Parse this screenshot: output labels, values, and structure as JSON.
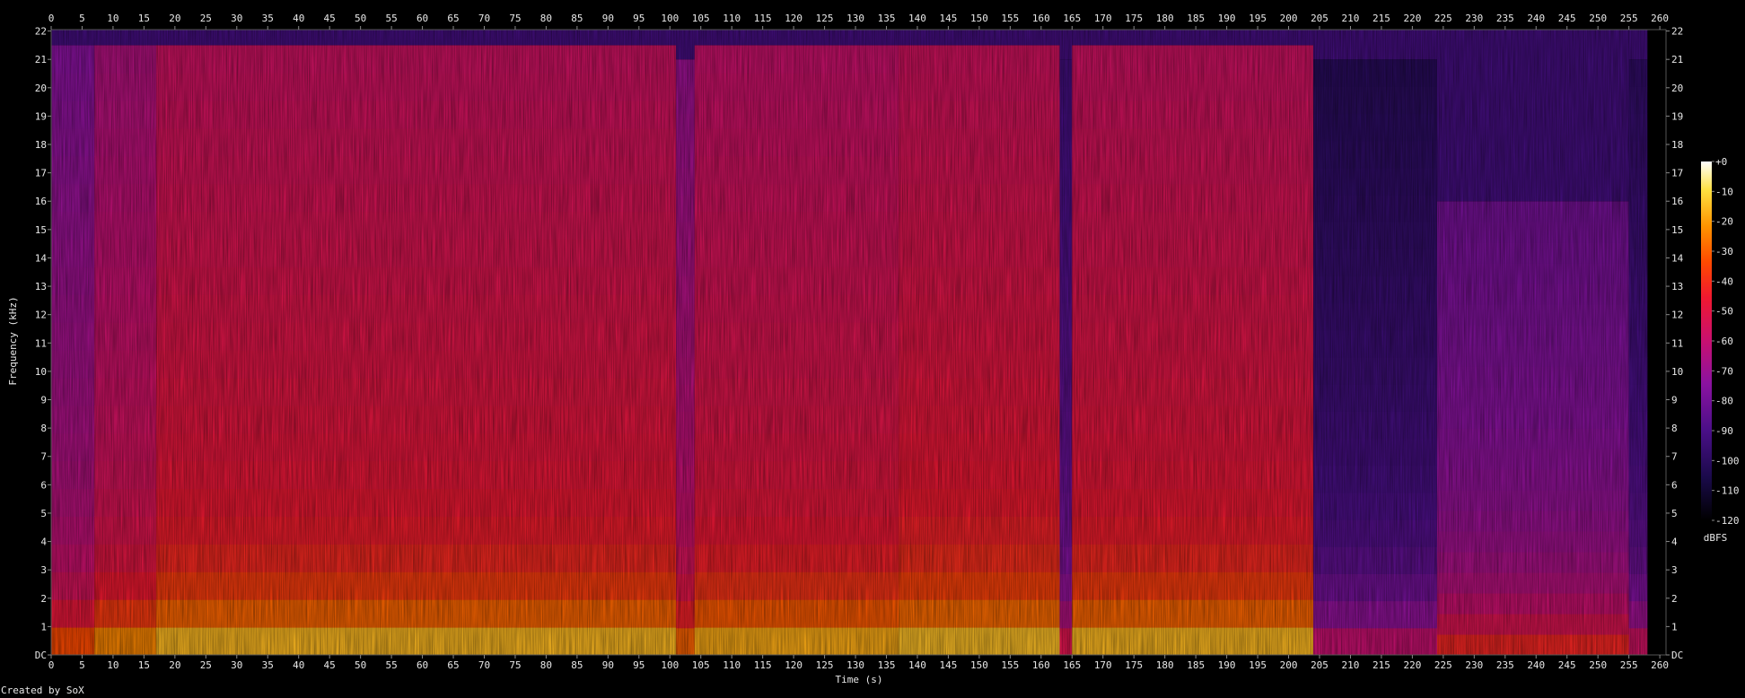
{
  "chart_data": {
    "type": "heatmap",
    "title": "",
    "xlabel": "Time (s)",
    "ylabel": "Frequency (kHz)",
    "xlim": [
      0,
      261
    ],
    "ylim": [
      0,
      22.05
    ],
    "x_ticks": [
      0,
      5,
      10,
      15,
      20,
      25,
      30,
      35,
      40,
      45,
      50,
      55,
      60,
      65,
      70,
      75,
      80,
      85,
      90,
      95,
      100,
      105,
      110,
      115,
      120,
      125,
      130,
      135,
      140,
      145,
      150,
      155,
      160,
      165,
      170,
      175,
      180,
      185,
      190,
      195,
      200,
      205,
      210,
      215,
      220,
      225,
      230,
      235,
      240,
      245,
      250,
      255,
      260
    ],
    "y_ticks": [
      "DC",
      "1",
      "2",
      "3",
      "4",
      "5",
      "6",
      "7",
      "8",
      "9",
      "10",
      "11",
      "12",
      "13",
      "14",
      "15",
      "16",
      "17",
      "18",
      "19",
      "20",
      "21",
      "22"
    ],
    "colorbar": {
      "label": "dBFS",
      "ticks": [
        "+0",
        "-10",
        "-20",
        "-30",
        "-40",
        "-50",
        "-60",
        "-70",
        "-80",
        "-90",
        "-100",
        "-110",
        "-120"
      ],
      "range": [
        -120,
        0
      ]
    },
    "segments": [
      {
        "start_s": 0,
        "end_s": 7,
        "level_db": -62,
        "cutoff_khz": 21.5
      },
      {
        "start_s": 7,
        "end_s": 17,
        "level_db": -52,
        "cutoff_khz": 21.5
      },
      {
        "start_s": 17,
        "end_s": 101,
        "level_db": -44,
        "cutoff_khz": 21.5
      },
      {
        "start_s": 101,
        "end_s": 104,
        "level_db": -58,
        "cutoff_khz": 21.0
      },
      {
        "start_s": 104,
        "end_s": 137,
        "level_db": -46,
        "cutoff_khz": 21.5
      },
      {
        "start_s": 137,
        "end_s": 163,
        "level_db": -43,
        "cutoff_khz": 21.5
      },
      {
        "start_s": 163,
        "end_s": 165,
        "level_db": -80,
        "cutoff_khz": 21.0
      },
      {
        "start_s": 165,
        "end_s": 204,
        "level_db": -44,
        "cutoff_khz": 21.5
      },
      {
        "start_s": 204,
        "end_s": 224,
        "level_db": -88,
        "cutoff_khz": 21.0
      },
      {
        "start_s": 224,
        "end_s": 255,
        "level_db": -70,
        "cutoff_khz": 16.0
      },
      {
        "start_s": 255,
        "end_s": 258,
        "level_db": -85,
        "cutoff_khz": 21.0
      }
    ],
    "colors": {
      "background": "#000000",
      "text": "#e8e8e8",
      "axis": "#888888"
    }
  },
  "credit": "Created by SoX"
}
